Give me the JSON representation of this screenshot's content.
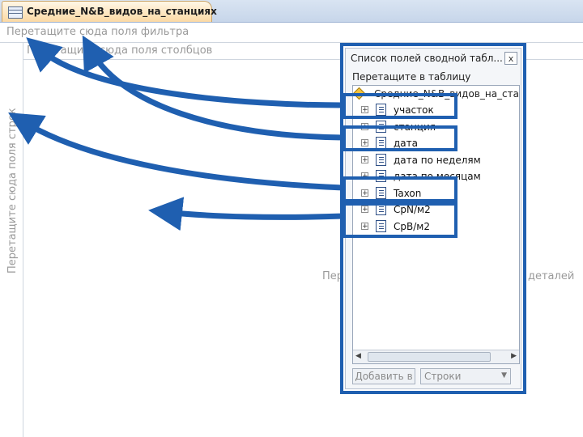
{
  "tab": {
    "title": "Средние_N&B_видов_на_станциях",
    "icon": "table-icon"
  },
  "pivot": {
    "filter_drop_label": "Перетащите сюда поля фильтра",
    "column_drop_label": "Перетащите сюда поля столбцов",
    "row_drop_label": "Перетащите сюда поля строк",
    "detail_left": "Пер",
    "detail_right": "деталей"
  },
  "field_list": {
    "title": "Список полей сводной табл...",
    "close_label": "x",
    "drag_label": "Перетащите в таблицу",
    "root_label": "Средние_N&B_видов_на_станц",
    "items": [
      {
        "label": "участок"
      },
      {
        "label": "станция"
      },
      {
        "label": "дата"
      },
      {
        "label": "дата по неделям"
      },
      {
        "label": "дата по месяцам"
      },
      {
        "label": "Taxon"
      },
      {
        "label": "CpN/м2"
      },
      {
        "label": "CpB/м2"
      }
    ],
    "add_button": "Добавить в",
    "area_select": "Строки"
  },
  "colors": {
    "annotation": "#1f5fb0",
    "tab": "#fbd9a4"
  }
}
